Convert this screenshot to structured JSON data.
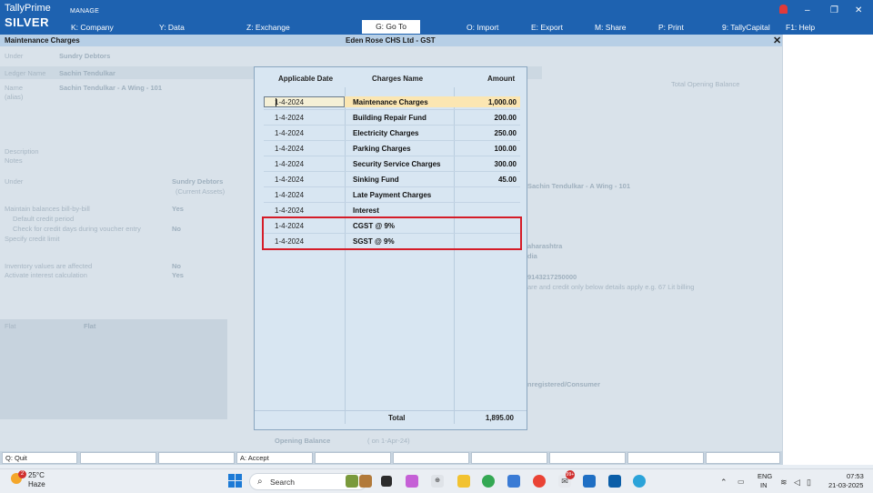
{
  "app": {
    "brand_top": "TallyPrime",
    "brand_edition": "SILVER",
    "manage_label": "MANAGE",
    "menu": [
      {
        "key": "K",
        "label": "K: Company"
      },
      {
        "key": "Y",
        "label": "Y: Data"
      },
      {
        "key": "Z",
        "label": "Z: Exchange"
      },
      {
        "key": "G",
        "label": "G: Go To"
      },
      {
        "key": "O",
        "label": "O: Import"
      },
      {
        "key": "E",
        "label": "E: Export"
      },
      {
        "key": "M",
        "label": "M: Share"
      },
      {
        "key": "P",
        "label": "P: Print"
      },
      {
        "key": "9",
        "label": "9: TallyCapital"
      },
      {
        "key": "F1",
        "label": "F1: Help"
      }
    ],
    "window_controls": {
      "minimize": "–",
      "restore": "❐",
      "close": "✕"
    }
  },
  "titlebar": {
    "screen": "Maintenance Charges",
    "company": "Eden Rose CHS Ltd - GST",
    "close": "✕"
  },
  "background_form": {
    "under_label": "Under",
    "under_value": "Sundry Debtors",
    "ledger_name_label": "Ledger Name",
    "ledger_name_value": "Sachin Tendulkar",
    "name_label": "Name",
    "name_value": "Sachin Tendulkar - A Wing - 101",
    "alias_label": "(alias)",
    "total_opening_balance": "Total Opening Balance",
    "description_label": "Description",
    "notes_label": "Notes",
    "under2_label": "Under",
    "under2_value": "Sundry Debtors",
    "current_assets": "(Current Assets)",
    "maintain_balances": "Maintain balances bill-by-bill",
    "maintain_value": "Yes",
    "default_credit": "Default credit period",
    "check_credit": "Check for credit days during voucher entry",
    "check_value": "No",
    "specify_credit": "Specify credit limit",
    "inventory_affected": "Inventory values are affected",
    "inventory_value": "No",
    "activate_interest": "Activate interest calculation",
    "interest_value": "Yes",
    "right_name": "Sachin Tendulkar - A Wing - 101",
    "state_partial": "aharashtra",
    "country_partial": "dia",
    "phone_partial": "9143217250000",
    "note_partial": "are and credit only below details apply e.g. 67 Lit billing",
    "reg_partial": "nregistered/Consumer",
    "flat_label": "Flat",
    "flat_value": "Flat",
    "opening_balance_label": "Opening Balance",
    "opening_balance_date": "( on 1-Apr-24)"
  },
  "modal": {
    "headers": {
      "date": "Applicable Date",
      "name": "Charges Name",
      "amount": "Amount"
    },
    "rows": [
      {
        "date": "1-4-2024",
        "name": "Maintenance Charges",
        "amount": "1,000.00"
      },
      {
        "date": "1-4-2024",
        "name": "Building Repair Fund",
        "amount": "200.00"
      },
      {
        "date": "1-4-2024",
        "name": "Electricity Charges",
        "amount": "250.00"
      },
      {
        "date": "1-4-2024",
        "name": "Parking Charges",
        "amount": "100.00"
      },
      {
        "date": "1-4-2024",
        "name": "Security Service Charges",
        "amount": "300.00"
      },
      {
        "date": "1-4-2024",
        "name": "Sinking Fund",
        "amount": "45.00"
      },
      {
        "date": "1-4-2024",
        "name": "Late Payment Charges",
        "amount": ""
      },
      {
        "date": "1-4-2024",
        "name": "Interest",
        "amount": ""
      },
      {
        "date": "1-4-2024",
        "name": "CGST @ 9%",
        "amount": ""
      },
      {
        "date": "1-4-2024",
        "name": "SGST @ 9%",
        "amount": ""
      }
    ],
    "total_label": "Total",
    "total_value": "1,895.00",
    "highlight_color": "#d51c28"
  },
  "buttonbar": {
    "quit": "Q: Quit",
    "accept": "A: Accept"
  },
  "taskbar": {
    "weather_temp": "25°C",
    "weather_desc": "Haze",
    "weather_badge": "2",
    "search_placeholder": "Search",
    "lang_top": "ENG",
    "lang_bottom": "IN",
    "time": "07:53",
    "date": "21-03-2025",
    "mail_badge": "99+"
  }
}
